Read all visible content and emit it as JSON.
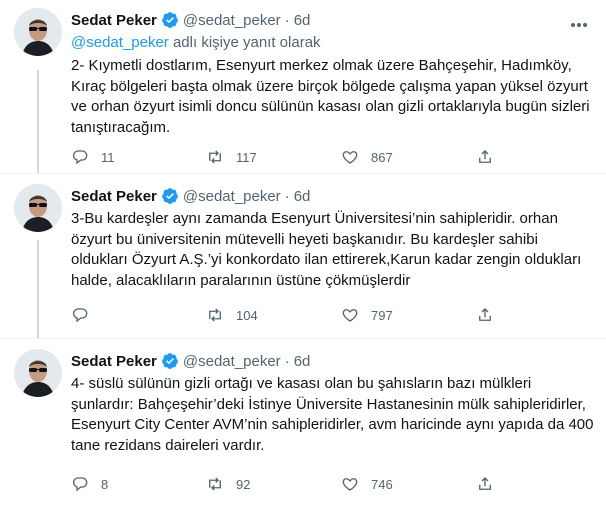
{
  "tweets": [
    {
      "name": "Sedat Peker",
      "handle": "@sedat_peker",
      "time": "6d",
      "reply_prefix_mention": "@sedat_peker",
      "reply_suffix": " adlı kişiye yanıt olarak",
      "text": "2- Kıymetli dostlarım, Esenyurt merkez olmak üzere Bahçeşehir, Hadımköy, Kıraç bölgeleri başta olmak üzere birçok bölgede çalışma yapan yüksel özyurt ve orhan özyurt isimli doncu sülünün kasası olan gizli ortaklarıyla bugün sizleri tanıştıracağım.",
      "replies": "11",
      "retweets": "117",
      "likes": "867"
    },
    {
      "name": "Sedat Peker",
      "handle": "@sedat_peker",
      "time": "6d",
      "text": "3-Bu kardeşler aynı zamanda Esenyurt  Üniversitesi’nin sahipleridir. orhan özyurt bu üniversitenin mütevelli heyeti başkanıdır. Bu kardeşler sahibi oldukları Özyurt A.Ş.’yi konkordato ilan ettirerek,Karun kadar zengin oldukları halde, alacaklıların paralarının üstüne çökmüşlerdir",
      "replies": "",
      "retweets": "104",
      "likes": "797"
    },
    {
      "name": "Sedat Peker",
      "handle": "@sedat_peker",
      "time": "6d",
      "text": "4- süslü sülünün gizli ortağı ve kasası olan bu şahısların bazı mülkleri şunlardır: Bahçeşehir’deki İstinye Üniversite Hastanesinin mülk sahipleridirler, Esenyurt City Center AVM’nin sahipleridirler, avm haricinde aynı yapıda da 400 tane rezidans daireleri vardır.",
      "replies": "8",
      "retweets": "92",
      "likes": "746"
    }
  ],
  "colors": {
    "accent": "#1d9bf0",
    "muted": "#536471",
    "text": "#0f1419",
    "divider": "#eff3f4"
  },
  "icons": [
    "reply-icon",
    "retweet-icon",
    "like-icon",
    "share-icon",
    "verified-badge-icon",
    "more-icon"
  ]
}
